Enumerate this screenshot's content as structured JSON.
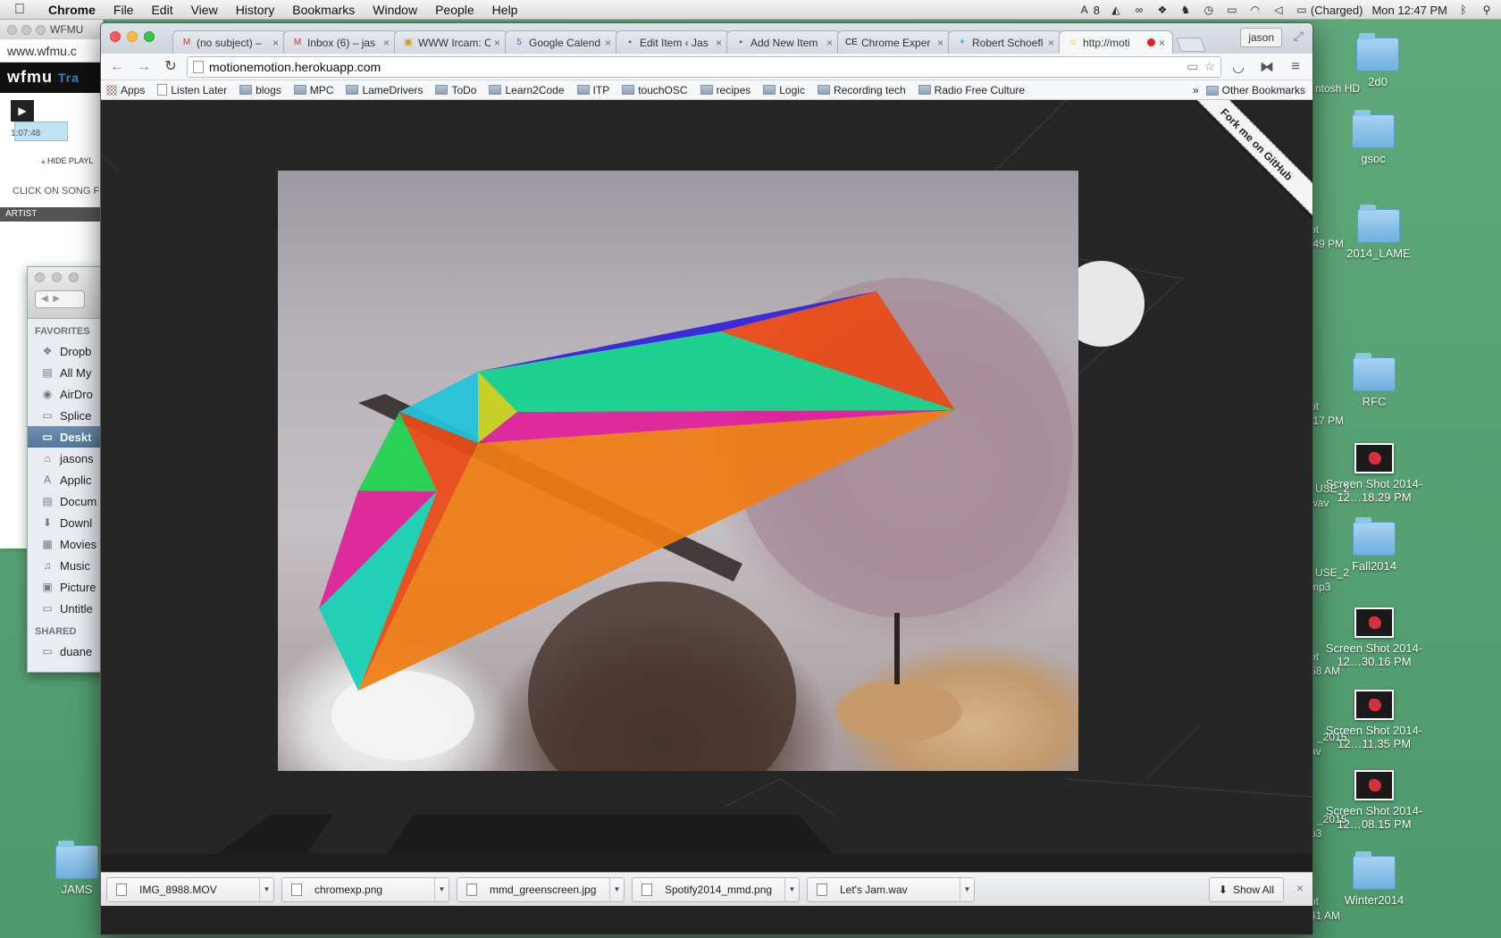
{
  "menubar": {
    "app": "Chrome",
    "items": [
      "File",
      "Edit",
      "View",
      "History",
      "Bookmarks",
      "Window",
      "People",
      "Help"
    ],
    "status": {
      "adobe_count": "8",
      "battery": "(Charged)",
      "clock": "Mon 12:47 PM"
    }
  },
  "wfmu": {
    "title": "WFMU",
    "url": "www.wfmu.c",
    "logo": "wfmu",
    "logo_suffix": "Tra",
    "time": "1:07:48",
    "hide_playlist": "HIDE PLAYL",
    "click_on_song": "CLICK ON SONG F",
    "artist_header": "ARTIST"
  },
  "finder": {
    "favorites_label": "FAVORITES",
    "shared_label": "SHARED",
    "favorites": [
      {
        "icon": "dropbox-icon",
        "glyph": "❖",
        "label": "Dropb"
      },
      {
        "icon": "all-my-files-icon",
        "glyph": "▤",
        "label": "All My"
      },
      {
        "icon": "airdrop-icon",
        "glyph": "◉",
        "label": "AirDro"
      },
      {
        "icon": "folder-icon",
        "glyph": "▭",
        "label": "Splice"
      },
      {
        "icon": "desktop-icon",
        "glyph": "▭",
        "label": "Deskt",
        "selected": true
      },
      {
        "icon": "home-icon",
        "glyph": "⌂",
        "label": "jasons"
      },
      {
        "icon": "applications-icon",
        "glyph": "A",
        "label": "Applic"
      },
      {
        "icon": "documents-icon",
        "glyph": "▤",
        "label": "Docum"
      },
      {
        "icon": "downloads-icon",
        "glyph": "⬇",
        "label": "Downl"
      },
      {
        "icon": "movies-icon",
        "glyph": "▦",
        "label": "Movies"
      },
      {
        "icon": "music-icon",
        "glyph": "♫",
        "label": "Music"
      },
      {
        "icon": "pictures-icon",
        "glyph": "▣",
        "label": "Picture"
      },
      {
        "icon": "folder-icon",
        "glyph": "▭",
        "label": "Untitle"
      }
    ],
    "shared": [
      {
        "icon": "shared-computer-icon",
        "glyph": "▭",
        "label": "duane"
      }
    ]
  },
  "chrome": {
    "profile": "jason",
    "tabs": [
      {
        "favicon": "gmail-icon",
        "glyph": "M",
        "color": "#d93025",
        "title": "(no subject) –",
        "active": false
      },
      {
        "favicon": "gmail-icon",
        "glyph": "M",
        "color": "#d93025",
        "title": "Inbox (6) – jas",
        "active": false
      },
      {
        "favicon": "ircam-icon",
        "glyph": "▣",
        "color": "#c8a000",
        "title": "WWW Ircam: O",
        "active": false
      },
      {
        "favicon": "calendar-icon",
        "glyph": "5",
        "color": "#3b6fd8",
        "title": "Google Calend",
        "active": false
      },
      {
        "favicon": "wordpress-icon",
        "glyph": "▪",
        "color": "#7a4a2a",
        "title": "Edit Item ‹ Jas",
        "active": false
      },
      {
        "favicon": "wordpress-icon",
        "glyph": "▪",
        "color": "#7a4a2a",
        "title": "Add New Item",
        "active": false
      },
      {
        "favicon": "chrome-experiments-icon",
        "glyph": "CE",
        "color": "#111111",
        "title": "Chrome Exper",
        "active": false
      },
      {
        "favicon": "twitter-icon",
        "glyph": "✦",
        "color": "#55acee",
        "title": "Robert Schoefl",
        "active": false
      },
      {
        "favicon": "smiley-icon",
        "glyph": "☺",
        "color": "#e8b400",
        "title": "http://moti",
        "active": true
      }
    ],
    "url": "motionemotion.herokuapp.com",
    "bookmarks": [
      {
        "type": "apps",
        "label": "Apps"
      },
      {
        "type": "page",
        "label": "Listen Later"
      },
      {
        "type": "folder",
        "label": "blogs"
      },
      {
        "type": "folder",
        "label": "MPC"
      },
      {
        "type": "folder",
        "label": "LameDrivers"
      },
      {
        "type": "folder",
        "label": "ToDo"
      },
      {
        "type": "folder",
        "label": "Learn2Code"
      },
      {
        "type": "folder",
        "label": "ITP"
      },
      {
        "type": "folder",
        "label": "touchOSC"
      },
      {
        "type": "folder",
        "label": "recipes"
      },
      {
        "type": "folder",
        "label": "Logic"
      },
      {
        "type": "folder",
        "label": "Recording tech"
      },
      {
        "type": "folder",
        "label": "Radio Free Culture"
      }
    ],
    "bookmarks_overflow": "»",
    "other_bookmarks": "Other Bookmarks",
    "fork_ribbon": "Fork me on GitHub",
    "downloads": [
      "IMG_8988.MOV",
      "chromexp.png",
      "mmd_greenscreen.jpg",
      "Spotify2014_mmd.png",
      "Let's Jam.wav"
    ],
    "show_all": "Show All"
  },
  "overlay": {
    "colors": {
      "orange": "#f07d14",
      "red_orange": "#ea4b16",
      "mint": "#14d48e",
      "green": "#20d250",
      "magenta": "#e0209a",
      "cyan": "#22c4dc",
      "yellow": "#c8d21e",
      "blue": "#3222dc",
      "teal": "#16d2b4"
    }
  },
  "desktop": {
    "icons": [
      {
        "kind": "folder",
        "label": "2d0"
      },
      {
        "kind": "folder",
        "label": "gsoc"
      },
      {
        "kind": "folder",
        "label": "2014_LAME"
      },
      {
        "kind": "folder",
        "label": "RFC"
      },
      {
        "kind": "shot",
        "label": "Screen Shot 2014-12…18.29 PM"
      },
      {
        "kind": "folder",
        "label": "Fall2014"
      },
      {
        "kind": "shot",
        "label": "Screen Shot 2014-12…30.16 PM"
      },
      {
        "kind": "shot",
        "label": "Screen Shot 2014-12…11.35 PM"
      },
      {
        "kind": "shot",
        "label": "Screen Shot 2014-12…08.15 PM"
      },
      {
        "kind": "folder",
        "label": "Winter2014"
      }
    ],
    "jams": "JAMS",
    "partials": [
      "ntosh HD",
      "ot",
      ".49 PM",
      "ot",
      ".17 PM",
      "USE_2",
      "wav",
      "USE_2",
      "mp3",
      "ot",
      "58 AM",
      "_2015",
      "av",
      "_2015",
      "p3",
      "ot",
      "41 AM"
    ]
  }
}
